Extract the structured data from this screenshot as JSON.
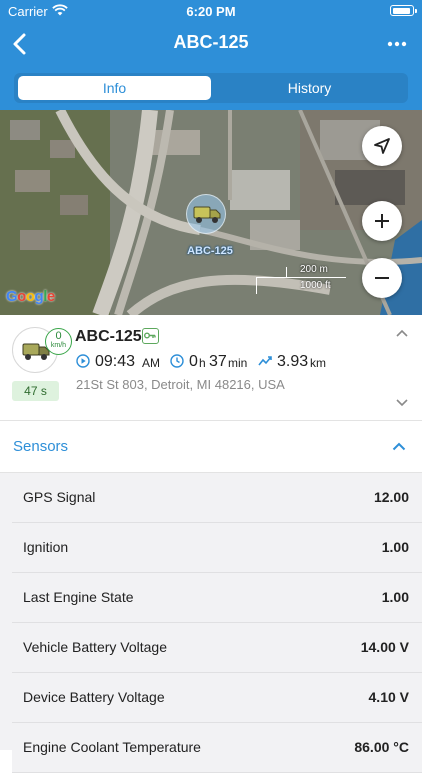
{
  "status_bar": {
    "carrier": "Carrier",
    "time": "6:20 PM"
  },
  "nav": {
    "title": "ABC-125"
  },
  "tabs": [
    {
      "label": "Info",
      "active": true
    },
    {
      "label": "History",
      "active": false
    }
  ],
  "map": {
    "vehicle_label": "ABC-125",
    "scale_metric": "200 m",
    "scale_imperial": "1000 ft",
    "attribution": "Google",
    "controls": [
      "locate-icon",
      "zoom-in-icon",
      "zoom-out-icon"
    ]
  },
  "vehicle": {
    "name": "ABC-125",
    "speed_value": "0",
    "speed_unit": "km/h",
    "age": "47 s",
    "time_value": "09:43",
    "time_suffix": "AM",
    "duration_hours": "0",
    "duration_h_unit": "h",
    "duration_minutes": "37",
    "duration_min_unit": "min",
    "distance_value": "3.93",
    "distance_unit": "km",
    "address": "21St St 803, Detroit, MI 48216, USA",
    "status_color": "#3aa64a"
  },
  "sensors_section": {
    "title": "Sensors",
    "rows": [
      {
        "label": "GPS Signal",
        "value": "12.00"
      },
      {
        "label": "Ignition",
        "value": "1.00"
      },
      {
        "label": "Last Engine State",
        "value": "1.00"
      },
      {
        "label": "Vehicle Battery Voltage",
        "value": "14.00 V"
      },
      {
        "label": "Device Battery Voltage",
        "value": "4.10 V"
      },
      {
        "label": "Engine Coolant Temperature",
        "value": "86.00 °C"
      }
    ]
  },
  "colors": {
    "brand": "#2e8fd8",
    "accent_green": "#3aa64a"
  }
}
